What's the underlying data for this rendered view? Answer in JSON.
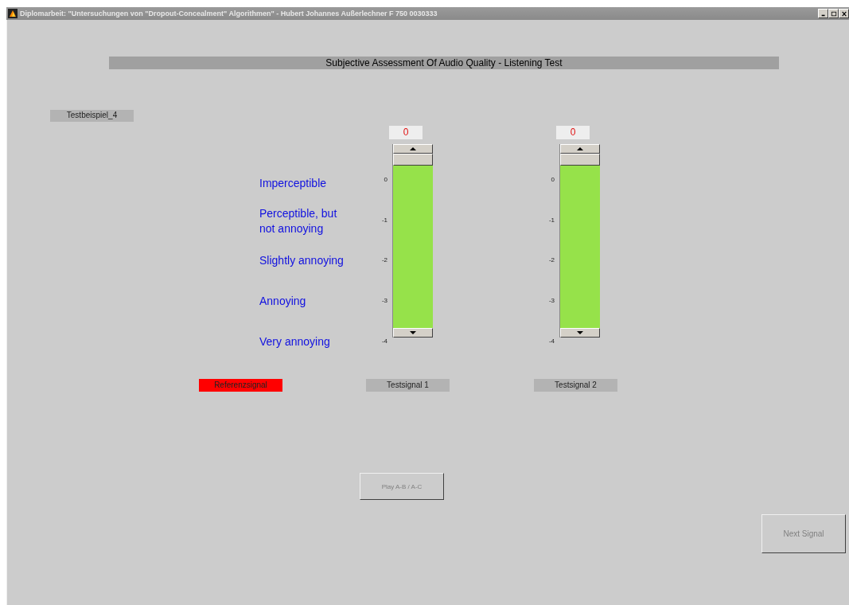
{
  "window": {
    "title": "Diplomarbeit: \"Untersuchungen von \"Dropout-Concealment\" Algorithmen\" - Hubert Johannes Außerlechner F 750 0030333"
  },
  "heading": "Subjective Assessment Of Audio Quality - Listening Test",
  "example_label": "Testbeispiel_4",
  "scale_labels": [
    "Imperceptible",
    "Perceptible, but not annoying",
    "Slightly annoying",
    "Annoying",
    "Very annoying"
  ],
  "sliders": [
    {
      "reading": "0",
      "level": 1,
      "ticks": [
        "0",
        "-1",
        "-2",
        "-3",
        "-4"
      ]
    },
    {
      "reading": "0",
      "level": 1,
      "ticks": [
        "0",
        "-1",
        "-2",
        "-3",
        "-4"
      ]
    }
  ],
  "signals": [
    {
      "label": "Referenzsignal",
      "selected": true
    },
    {
      "label": "Testsignal 1",
      "selected": false
    },
    {
      "label": "Testsignal 2",
      "selected": false
    }
  ],
  "play_button": {
    "label": "Play A-B  / A-C",
    "disabled": true
  },
  "next_button": {
    "label": "Next Signal",
    "disabled": true
  }
}
